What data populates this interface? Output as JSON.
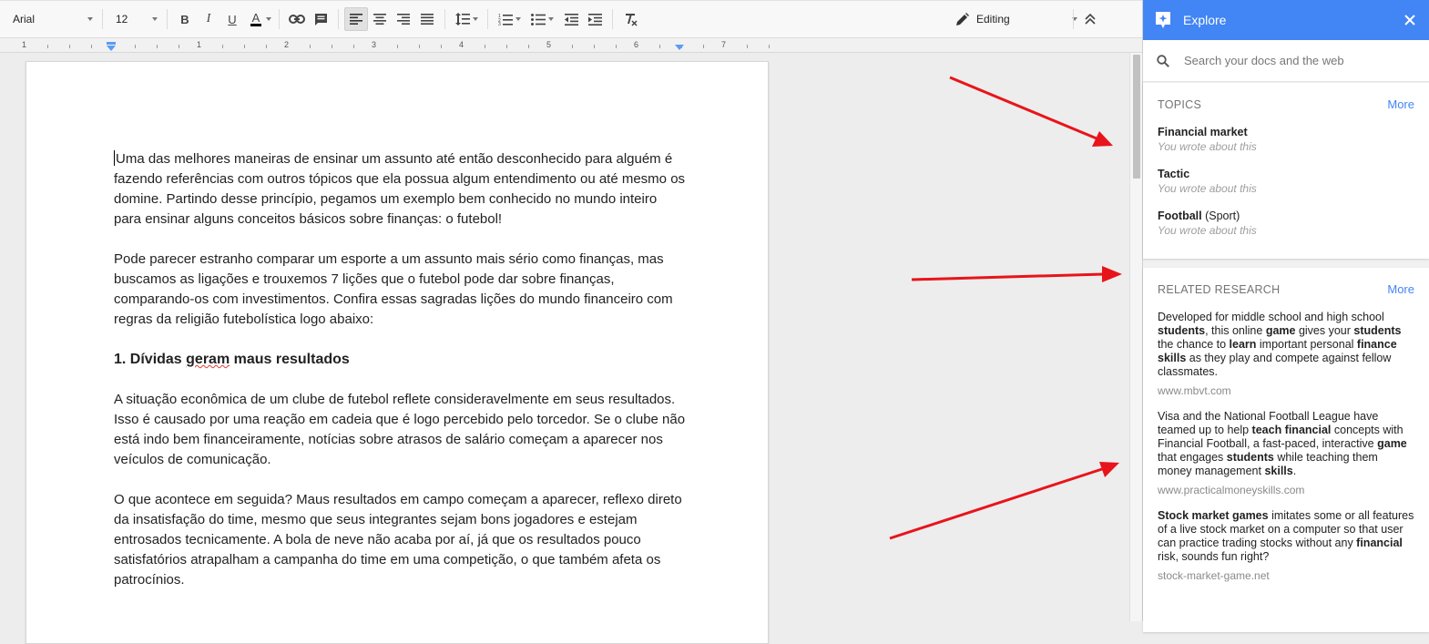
{
  "toolbar": {
    "font_family": "Arial",
    "font_size": "12",
    "mode_label": "Editing"
  },
  "ruler": {
    "numbers": [
      "1",
      "1",
      "2",
      "3",
      "4",
      "5",
      "6",
      "7"
    ]
  },
  "document": {
    "paragraphs": [
      "Uma das melhores maneiras de ensinar um assunto até então desconhecido para alguém é fazendo referências com outros tópicos que ela possua algum entendimento ou até mesmo os domine. Partindo desse princípio, pegamos um exemplo bem conhecido no mundo inteiro para ensinar alguns conceitos básicos sobre finanças: o futebol!",
      "Pode parecer estranho comparar um esporte a um assunto mais sério como finanças, mas buscamos as ligações e trouxemos 7 lições que o futebol pode dar sobre finanças, comparando-os com investimentos. Confira essas sagradas lições do mundo financeiro com regras da religião futebolística logo abaixo:",
      "A situação econômica de um clube de futebol reflete consideravelmente em seus resultados. Isso é causado por uma reação em cadeia que é logo percebido pelo torcedor. Se o clube não está indo bem financeiramente, notícias sobre atrasos de salário começam a aparecer nos veículos de comunicação.",
      "O que acontece em seguida? Maus resultados em campo começam a aparecer, reflexo direto da insatisfação do time, mesmo que seus integrantes sejam bons jogadores e estejam entrosados tecnicamente. A bola de neve não acaba por aí, já que os resultados pouco satisfatórios atrapalham a campanha do time em uma competição, o que também afeta os patrocínios."
    ],
    "heading_pre": "1. Dívidas ",
    "heading_misspelled": "geram",
    "heading_post": " maus resultados"
  },
  "explore": {
    "title": "Explore",
    "search_placeholder": "Search your docs and the web",
    "topics": {
      "title": "TOPICS",
      "more": "More",
      "items": [
        {
          "name": "Financial market",
          "qualifier": "",
          "sub": "You wrote about this"
        },
        {
          "name": "Tactic",
          "qualifier": "",
          "sub": "You wrote about this"
        },
        {
          "name": "Football",
          "qualifier": " (Sport)",
          "sub": "You wrote about this"
        }
      ]
    },
    "research": {
      "title": "RELATED RESEARCH",
      "more": "More",
      "items": [
        {
          "text": "Developed for middle school and high school students, this online game gives your students the chance to learn important personal finance skills as they play and compete against fellow classmates.",
          "source": "www.mbvt.com"
        },
        {
          "text": "Visa and the National Football League have teamed up to help teach financial concepts with Financial Football, a fast-paced, interactive game that engages students while teaching them money management skills.",
          "source": "www.practicalmoneyskills.com"
        },
        {
          "text": "Stock market games imitates some or all features of a live stock market on a computer so that user can practice trading stocks without any financial risk, sounds fun right?",
          "source": "stock-market-game.net"
        }
      ]
    }
  },
  "colors": {
    "accent": "#4285f4",
    "arrow": "#e8141b"
  }
}
